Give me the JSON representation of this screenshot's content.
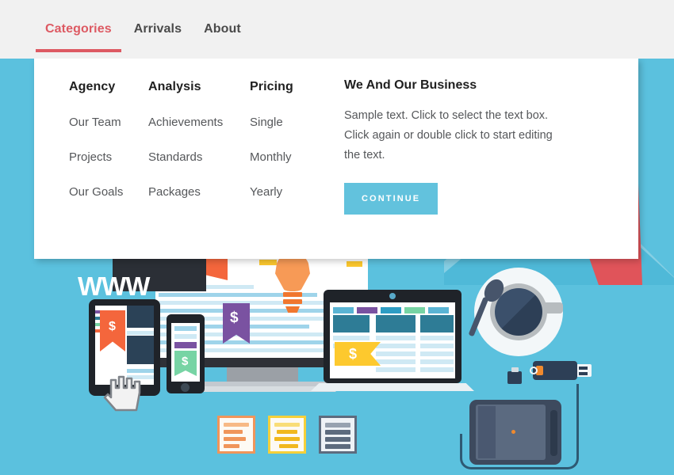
{
  "nav": {
    "items": [
      {
        "label": "Categories",
        "active": true
      },
      {
        "label": "Arrivals",
        "active": false
      },
      {
        "label": "About",
        "active": false
      }
    ]
  },
  "dropdown": {
    "columns": [
      {
        "heading": "Agency",
        "links": [
          "Our Team",
          "Projects",
          "Our Goals"
        ]
      },
      {
        "heading": "Analysis",
        "links": [
          "Achievements",
          "Standards",
          "Packages"
        ]
      },
      {
        "heading": "Pricing",
        "links": [
          "Single",
          "Monthly",
          "Yearly"
        ]
      }
    ],
    "promo": {
      "title": "We And Our Business",
      "body": "Sample text. Click to select the text box. Click again or double click to start editing the text.",
      "button_label": "CONTINUE"
    }
  },
  "illustration": {
    "www_label": "WWW",
    "currency_symbol": "$"
  },
  "colors": {
    "page_background": "#5bc1de",
    "navbar_background": "#f1f1f1",
    "active_nav": "#dd5a63",
    "dropdown_background": "#ffffff",
    "button": "#62c2dd",
    "heading_text": "#1f1f1f",
    "link_text": "#55575a",
    "arrow_red": "#e0545a",
    "arrow_blue_light": "#86cfe4",
    "arrow_blue_mid": "#4fb9d8",
    "arrow_blue_dark": "#3e9dbb"
  }
}
